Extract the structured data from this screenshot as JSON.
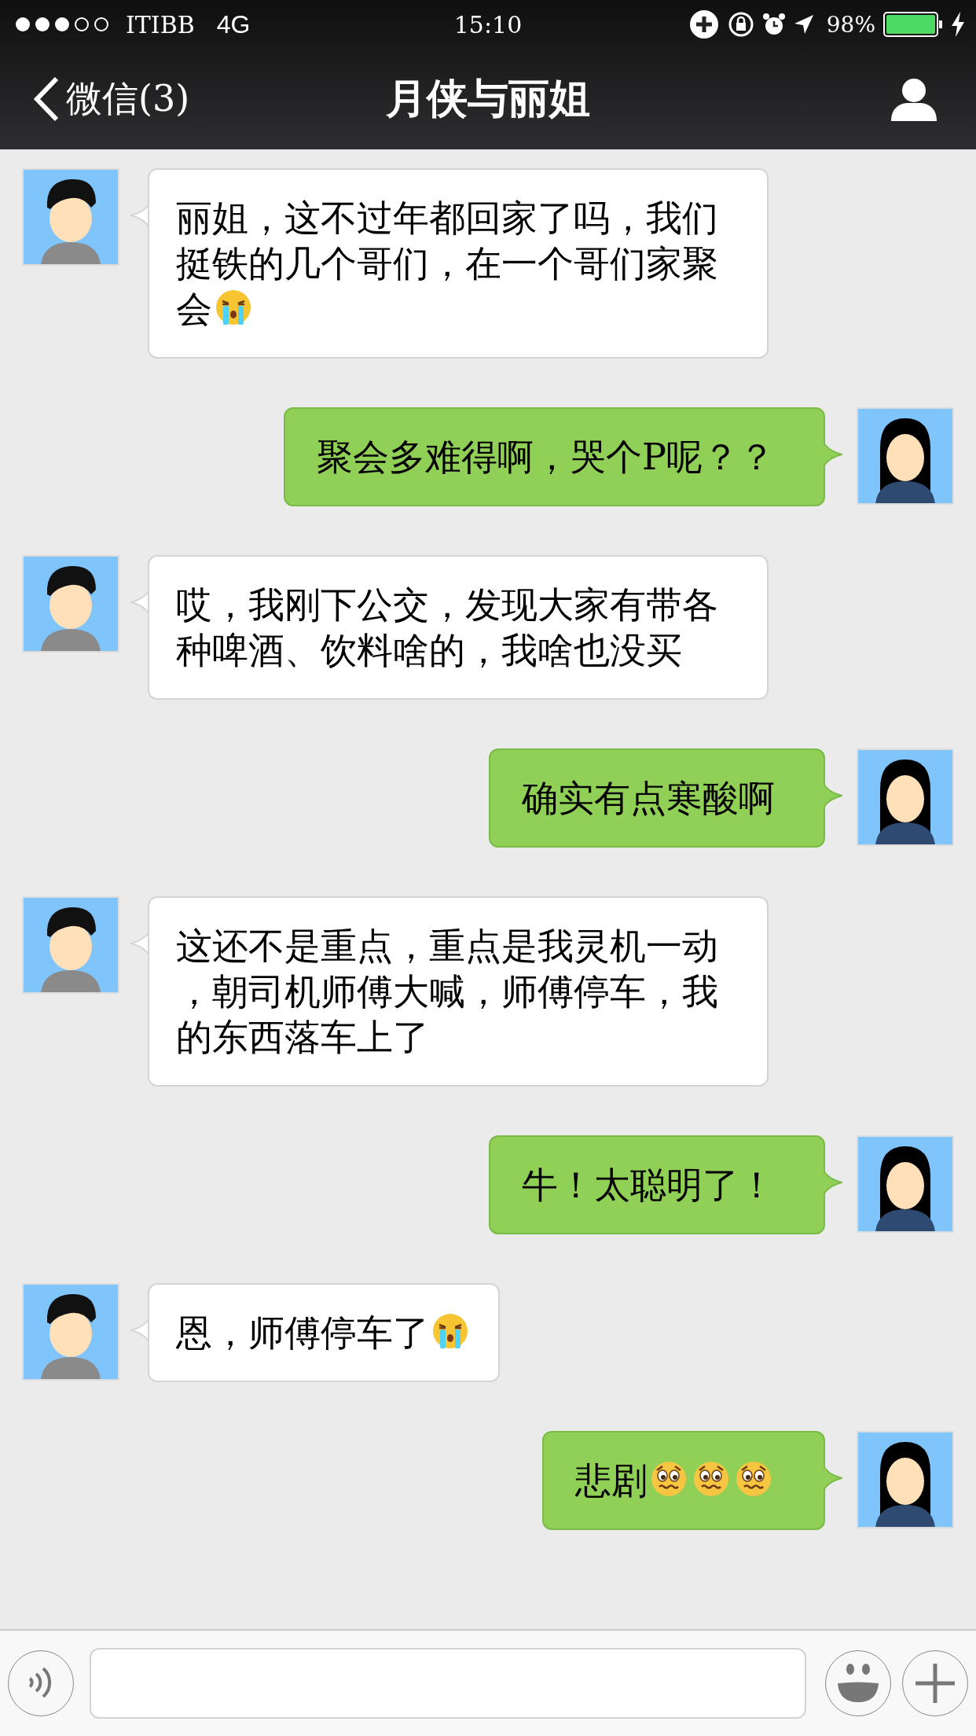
{
  "status_bar": {
    "carrier": "ITIBB",
    "network": "4G",
    "time": "15:10",
    "battery": "98%"
  },
  "nav": {
    "back": "微信(3)",
    "title": "月侠与丽姐"
  },
  "messages": [
    {
      "kind": "incoming",
      "parts": [
        {
          "kind": "text",
          "text": "丽姐，这不过年都回家了吗，我们挺铁的几个哥们，在一个哥们家聚"
        },
        {
          "kind": "text",
          "text": "会"
        },
        {
          "kind": "crying"
        }
      ]
    },
    {
      "kind": "outgoing",
      "parts": [
        {
          "kind": "text",
          "text": "聚会多难得啊，哭个P呢？？"
        }
      ]
    },
    {
      "kind": "incoming",
      "parts": [
        {
          "kind": "text",
          "text": "哎，我刚下公交，发现大家有带各种啤酒、饮料啥的，我啥也没买"
        }
      ]
    },
    {
      "kind": "outgoing",
      "parts": [
        {
          "kind": "text",
          "text": "确实有点寒酸啊"
        }
      ]
    },
    {
      "kind": "incoming",
      "parts": [
        {
          "kind": "text",
          "text": "这还不是重点，重点是我灵机一动，朝司机师傅大喊，师傅停车，我的东西落车上了"
        }
      ]
    },
    {
      "kind": "outgoing",
      "parts": [
        {
          "kind": "text",
          "text": "牛！太聪明了！"
        }
      ]
    },
    {
      "kind": "incoming",
      "parts": [
        {
          "kind": "text",
          "text": "恩，师傅停车了"
        },
        {
          "kind": "crying"
        }
      ]
    },
    {
      "kind": "outgoing",
      "parts": [
        {
          "kind": "text",
          "text": "悲剧"
        },
        {
          "kind": "worried"
        },
        {
          "kind": "worried"
        },
        {
          "kind": "worried"
        }
      ]
    }
  ]
}
